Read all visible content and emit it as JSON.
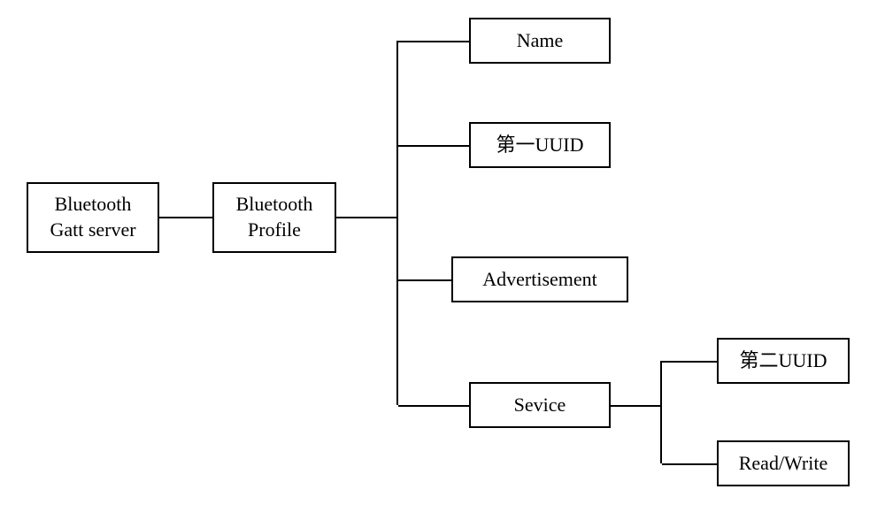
{
  "chart_data": {
    "type": "diagram",
    "nodes": [
      {
        "id": "gatt-server",
        "label": "Bluetooth\nGatt server"
      },
      {
        "id": "profile",
        "label": "Bluetooth\nProfile"
      },
      {
        "id": "name",
        "label": "Name"
      },
      {
        "id": "uuid1",
        "label": "第一UUID"
      },
      {
        "id": "advertisement",
        "label": "Advertisement"
      },
      {
        "id": "service",
        "label": "Sevice"
      },
      {
        "id": "uuid2",
        "label": "第二UUID"
      },
      {
        "id": "readwrite",
        "label": "Read/Write"
      }
    ],
    "edges": [
      {
        "from": "gatt-server",
        "to": "profile"
      },
      {
        "from": "profile",
        "to": "name"
      },
      {
        "from": "profile",
        "to": "uuid1"
      },
      {
        "from": "profile",
        "to": "advertisement"
      },
      {
        "from": "profile",
        "to": "service"
      },
      {
        "from": "service",
        "to": "uuid2"
      },
      {
        "from": "service",
        "to": "readwrite"
      }
    ]
  },
  "boxes": {
    "gatt_server": "Bluetooth\nGatt server",
    "profile": "Bluetooth\nProfile",
    "name": "Name",
    "uuid1": "第一UUID",
    "advertisement": "Advertisement",
    "service": "Sevice",
    "uuid2": "第二UUID",
    "readwrite": "Read/Write"
  }
}
